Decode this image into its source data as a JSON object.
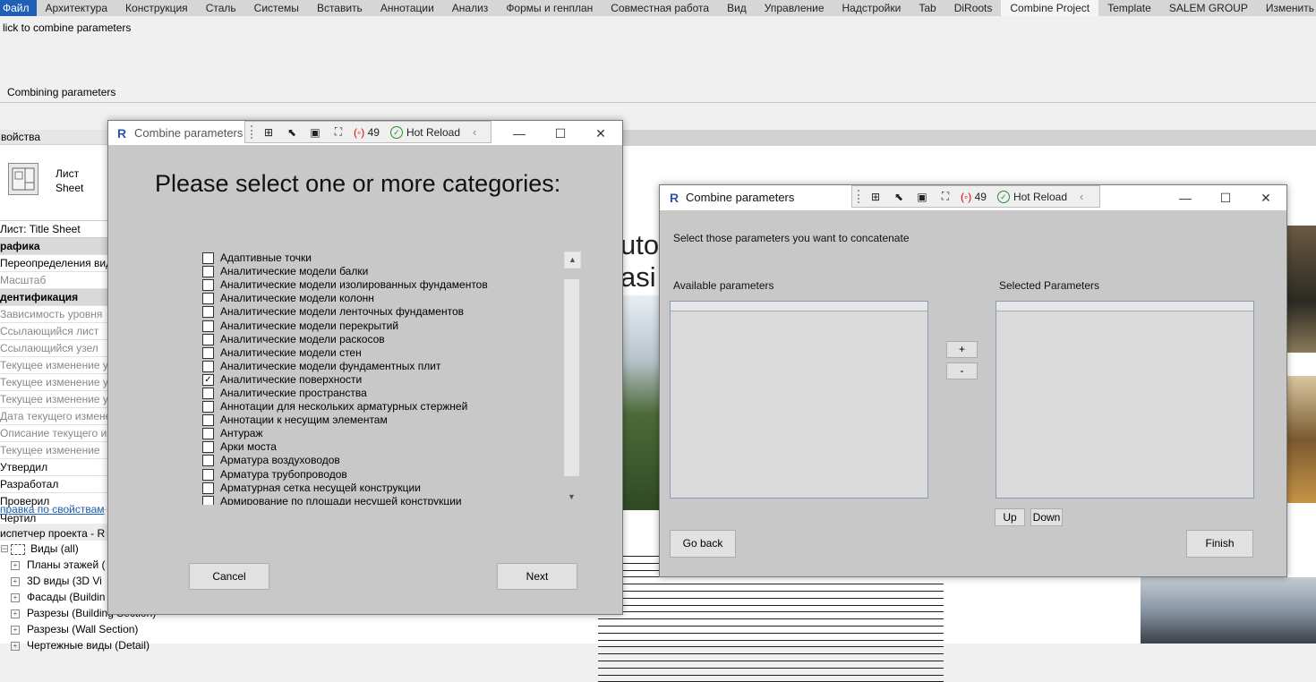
{
  "ribbon": {
    "tabs": [
      "Файл",
      "Архитектура",
      "Конструкция",
      "Сталь",
      "Системы",
      "Вставить",
      "Аннотации",
      "Анализ",
      "Формы и генплан",
      "Совместная работа",
      "Вид",
      "Управление",
      "Надстройки",
      "Tab",
      "DiRoots",
      "Combine Project",
      "Template",
      "SALEM GROUP",
      "Изменить"
    ],
    "active_tab": "Combine Project",
    "hint": "lick to combine parameters",
    "panel_label": "Combining parameters"
  },
  "properties": {
    "title": "войства",
    "type_name": "Лист",
    "type_sub": "Sheet",
    "selector": "Лист: Title Sheet",
    "rows": [
      {
        "text": "рафика",
        "kind": "cat"
      },
      {
        "text": "Переопределения вид",
        "kind": "normal"
      },
      {
        "text": "Масштаб",
        "kind": "gray"
      },
      {
        "text": "дентификация",
        "kind": "cat"
      },
      {
        "text": "Зависимость уровня",
        "kind": "gray"
      },
      {
        "text": "Ссылающийся лист",
        "kind": "gray"
      },
      {
        "text": "Ссылающийся узел",
        "kind": "gray"
      },
      {
        "text": "Текущее изменение у",
        "kind": "gray"
      },
      {
        "text": "Текущее изменение у",
        "kind": "gray"
      },
      {
        "text": "Текущее изменение у",
        "kind": "gray"
      },
      {
        "text": "Дата текущего измене",
        "kind": "gray"
      },
      {
        "text": "Описание текущего из",
        "kind": "gray"
      },
      {
        "text": "Текущее изменение",
        "kind": "gray"
      },
      {
        "text": "Утвердил",
        "kind": "normal"
      },
      {
        "text": "Разработал",
        "kind": "normal"
      },
      {
        "text": "Проверил",
        "kind": "normal"
      },
      {
        "text": "Чертил",
        "kind": "normal"
      }
    ],
    "help_link": "правка по свойствам"
  },
  "browser": {
    "title": "испетчер проекта - R",
    "root": "Виды (all)",
    "items": [
      "Планы этажей (",
      "3D виды (3D Vi",
      "Фасады (Buildin",
      "Разрезы (Building Section)",
      "Разрезы (Wall Section)",
      "Чертежные виды (Detail)"
    ]
  },
  "canvas": {
    "sheet_text_1": "uto",
    "sheet_text_2": "asi"
  },
  "dialog1": {
    "title": "Combine parameters",
    "error_count": "49",
    "hot_reload": "Hot Reload",
    "heading": "Please select one or more categories:",
    "categories": [
      {
        "label": "Адаптивные точки",
        "checked": false
      },
      {
        "label": "Аналитические модели балки",
        "checked": false
      },
      {
        "label": "Аналитические модели изолированных фундаментов",
        "checked": false
      },
      {
        "label": "Аналитические модели колонн",
        "checked": false
      },
      {
        "label": "Аналитические модели ленточных фундаментов",
        "checked": false
      },
      {
        "label": "Аналитические модели перекрытий",
        "checked": false
      },
      {
        "label": "Аналитические модели раскосов",
        "checked": false
      },
      {
        "label": "Аналитические модели стен",
        "checked": false
      },
      {
        "label": "Аналитические модели фундаментных плит",
        "checked": false
      },
      {
        "label": "Аналитические поверхности",
        "checked": true
      },
      {
        "label": "Аналитические пространства",
        "checked": false
      },
      {
        "label": "Аннотации для нескольких арматурных стержней",
        "checked": false
      },
      {
        "label": "Аннотации к несущим элементам",
        "checked": false
      },
      {
        "label": "Антураж",
        "checked": false
      },
      {
        "label": "Арки моста",
        "checked": false
      },
      {
        "label": "Арматура воздуховодов",
        "checked": false
      },
      {
        "label": "Арматура трубопроводов",
        "checked": false
      },
      {
        "label": "Арматурная сетка несущей конструкции",
        "checked": false
      },
      {
        "label": "Армирование по площади несущей конструкции",
        "checked": false
      }
    ],
    "cancel_label": "Cancel",
    "next_label": "Next"
  },
  "dialog2": {
    "title": "Combine parameters",
    "error_count": "49",
    "hot_reload": "Hot Reload",
    "instruction": "Select those parameters you want to concatenate",
    "available_label": "Available parameters",
    "selected_label": "Selected Parameters",
    "add_label": "+",
    "remove_label": "-",
    "up_label": "Up",
    "down_label": "Down",
    "go_back_label": "Go back",
    "finish_label": "Finish"
  }
}
